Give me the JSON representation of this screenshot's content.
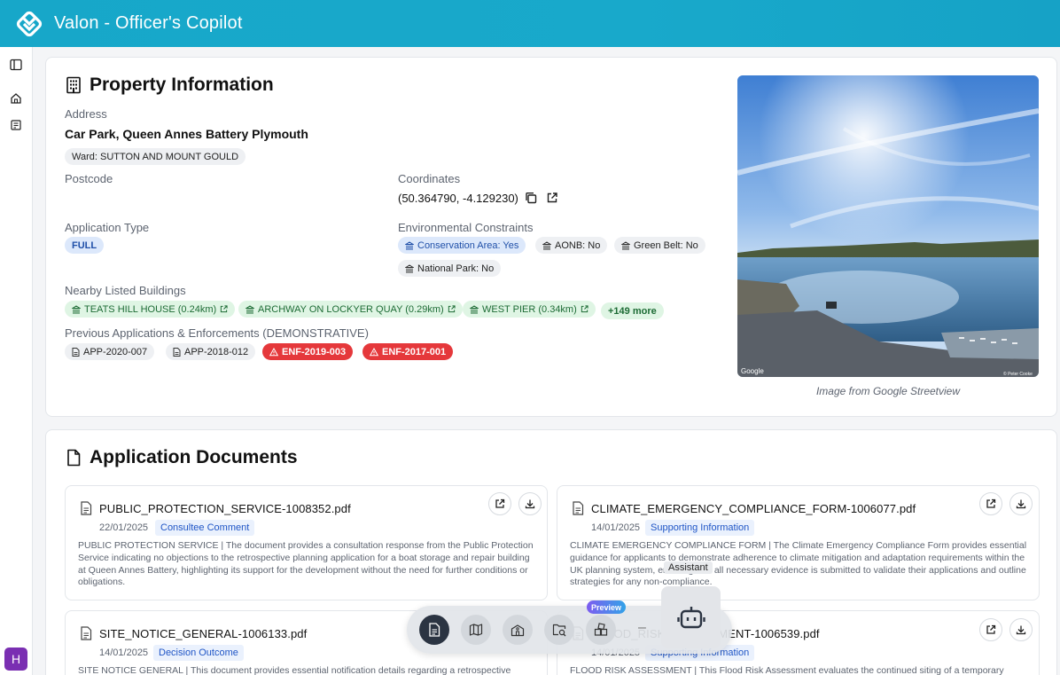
{
  "app": {
    "title": "Valon - Officer's Copilot"
  },
  "user": {
    "avatar_initial": "H"
  },
  "property": {
    "heading": "Property Information",
    "address_label": "Address",
    "address": "Car Park, Queen Annes Battery Plymouth",
    "ward": "Ward: SUTTON AND MOUNT GOULD",
    "postcode_label": "Postcode",
    "coordinates_label": "Coordinates",
    "coordinates": "(50.364790, -4.129230)",
    "application_type_label": "Application Type",
    "application_type": "FULL",
    "constraints_label": "Environmental Constraints",
    "constraints": [
      "Conservation Area: Yes",
      "AONB: No",
      "Green Belt: No",
      "National Park: No"
    ],
    "listed_label": "Nearby Listed Buildings",
    "listed": [
      "TEATS HILL HOUSE (0.24km)",
      "ARCHWAY ON LOCKYER QUAY (0.29km)",
      "WEST PIER (0.34km)"
    ],
    "listed_more": "+149 more",
    "previous_label": "Previous Applications & Enforcements (DEMONSTRATIVE)",
    "previous": [
      "APP-2020-007",
      "APP-2018-012",
      "ENF-2019-003",
      "ENF-2017-001"
    ],
    "image_caption": "Image from Google Streetview",
    "image_watermark": "Google",
    "image_credit": "© Peter Cooke"
  },
  "documents": {
    "heading": "Application Documents",
    "items": [
      {
        "title": "PUBLIC_PROTECTION_SERVICE-1008352.pdf",
        "date": "22/01/2025",
        "tag": "Consultee Comment",
        "desc": "PUBLIC PROTECTION SERVICE | The document provides a consultation response from the Public Protection Service indicating no objections to the retrospective planning application for a boat storage and repair building at Queen Annes Battery, highlighting its support for the development without the need for further conditions or obligations."
      },
      {
        "title": "CLIMATE_EMERGENCY_COMPLIANCE_FORM-1006077.pdf",
        "date": "14/01/2025",
        "tag": "Supporting Information",
        "desc": "CLIMATE EMERGENCY COMPLIANCE FORM | The Climate Emergency Compliance Form provides essential guidance for applicants to demonstrate adherence to climate mitigation and adaptation requirements within the UK planning system, ensuring that all necessary evidence is submitted to validate their applications and outline strategies for any non-compliance."
      },
      {
        "title": "SITE_NOTICE_GENERAL-1006133.pdf",
        "date": "14/01/2025",
        "tag": "Decision Outcome",
        "desc": "SITE NOTICE GENERAL | This document provides essential notification details regarding a retrospective"
      },
      {
        "title": "FLOOD_RISK_ASSESSMENT-1006539.pdf",
        "date": "14/01/2025",
        "tag": "Supporting Information",
        "desc": "FLOOD RISK ASSESSMENT | This Flood Risk Assessment evaluates the continued siting of a temporary"
      }
    ]
  },
  "dock": {
    "preview_label": "Preview",
    "assistant_tooltip": "Assistant",
    "divider": "–"
  }
}
